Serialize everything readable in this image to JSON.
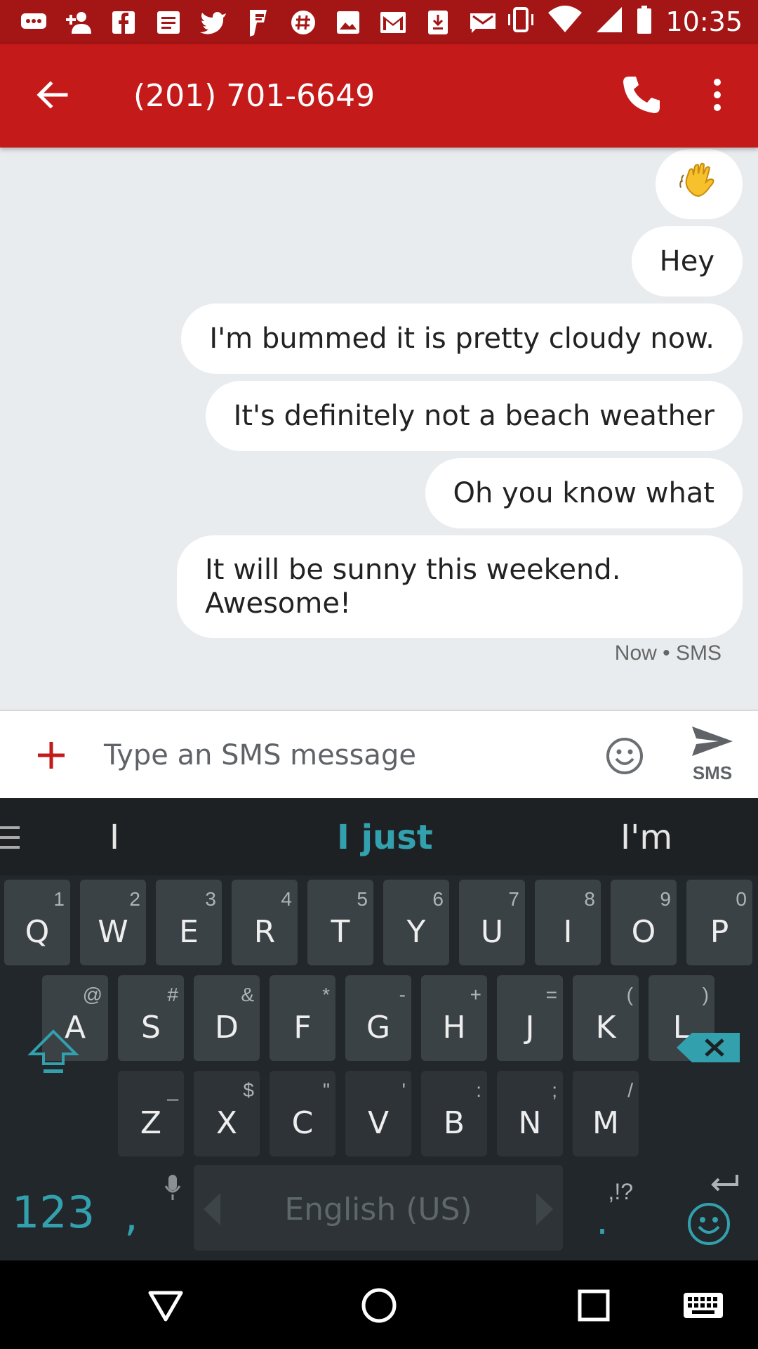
{
  "status_bar": {
    "time": "10:35",
    "notification_icons": [
      "chat-bubble-icon",
      "add-person-icon",
      "facebook-icon",
      "list-icon",
      "twitter-icon",
      "foursquare-icon",
      "hash-icon",
      "image-icon",
      "gmail-icon",
      "download-icon",
      "mail-icon"
    ],
    "system_icons": [
      "vibrate-icon",
      "wifi-icon",
      "signal-icon",
      "battery-icon"
    ]
  },
  "app_bar": {
    "title": "(201) 701-6649",
    "accent": "#c41a1a"
  },
  "messages": [
    {
      "text": "👋"
    },
    {
      "text": "Hey"
    },
    {
      "text": "I'm bummed it is pretty cloudy now."
    },
    {
      "text": "It's definitely not a beach weather"
    },
    {
      "text": "Oh you know what"
    },
    {
      "text": "It will be sunny this weekend.",
      "text2": "Awesome!"
    }
  ],
  "message_meta": "Now • SMS",
  "compose": {
    "placeholder": "Type an SMS message",
    "send_label": "SMS"
  },
  "keyboard": {
    "suggestions": [
      "I",
      "I just",
      "I'm"
    ],
    "row1": [
      {
        "k": "Q",
        "h": "1"
      },
      {
        "k": "W",
        "h": "2"
      },
      {
        "k": "E",
        "h": "3"
      },
      {
        "k": "R",
        "h": "4"
      },
      {
        "k": "T",
        "h": "5"
      },
      {
        "k": "Y",
        "h": "6"
      },
      {
        "k": "U",
        "h": "7"
      },
      {
        "k": "I",
        "h": "8"
      },
      {
        "k": "O",
        "h": "9"
      },
      {
        "k": "P",
        "h": "0"
      }
    ],
    "row2": [
      {
        "k": "A",
        "h": "@"
      },
      {
        "k": "S",
        "h": "#"
      },
      {
        "k": "D",
        "h": "&"
      },
      {
        "k": "F",
        "h": "*"
      },
      {
        "k": "G",
        "h": "-"
      },
      {
        "k": "H",
        "h": "+"
      },
      {
        "k": "J",
        "h": "="
      },
      {
        "k": "K",
        "h": "("
      },
      {
        "k": "L",
        "h": ")"
      }
    ],
    "row3": [
      {
        "k": "Z",
        "h": "_"
      },
      {
        "k": "X",
        "h": "$"
      },
      {
        "k": "C",
        "h": "\""
      },
      {
        "k": "V",
        "h": "'"
      },
      {
        "k": "B",
        "h": ":"
      },
      {
        "k": "N",
        "h": ";"
      },
      {
        "k": "M",
        "h": "/"
      }
    ],
    "symbols_key": "123",
    "comma_key": ",",
    "space_label": "English (US)",
    "period_key": ".",
    "period_hint": ",!?",
    "accent": "#33a0ae"
  }
}
